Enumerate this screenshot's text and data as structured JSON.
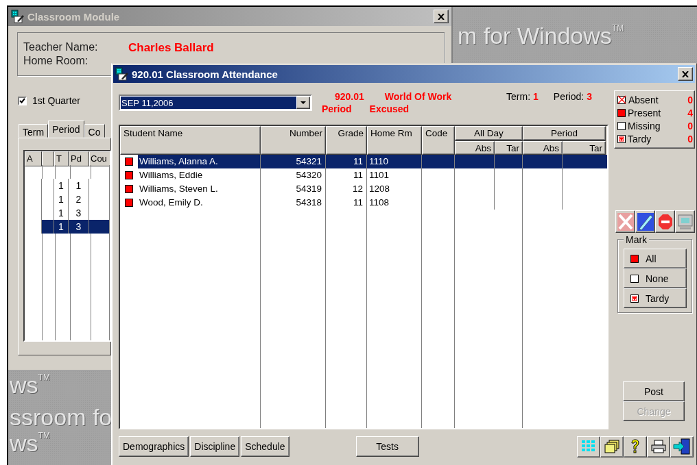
{
  "desktop": {
    "wallpaper_texts": [
      "m for Windows$^{TM}$",
      "ws$^{TM}$",
      "ssroom fo",
      "ws$^{TM}$"
    ]
  },
  "classroom_window": {
    "title": "Classroom Module",
    "teacher_label": "Teacher Name:",
    "teacher_name": "Charles Ballard",
    "home_room_label": "Home Room:",
    "quarter": {
      "label": "1st Quarter",
      "checked": true
    },
    "tabs": [
      {
        "label": "Term",
        "selected": false
      },
      {
        "label": "Period",
        "selected": true
      },
      {
        "label": "Co",
        "selected": false
      }
    ],
    "grid": {
      "columns": [
        "A",
        "T",
        "Pd",
        "Cou"
      ],
      "rows": [
        {
          "t": "1",
          "pd": "1",
          "selected": false
        },
        {
          "t": "1",
          "pd": "2",
          "selected": false
        },
        {
          "t": "1",
          "pd": "3",
          "selected": false
        },
        {
          "t": "1",
          "pd": "3",
          "selected": true
        }
      ]
    }
  },
  "attendance_window": {
    "title": "920.01 Classroom Attendance",
    "date": "SEP 11,2006",
    "course_number": "920.01",
    "course_name": "World Of Work",
    "line_2": [
      "Period",
      "Excused"
    ],
    "term_label": "Term:",
    "term": "1",
    "period_label": "Period:",
    "period": "3",
    "legend": [
      {
        "kind": "absent",
        "label": "Absent",
        "count": "0"
      },
      {
        "kind": "present",
        "label": "Present",
        "count": "4"
      },
      {
        "kind": "missing",
        "label": "Missing",
        "count": "0"
      },
      {
        "kind": "tardy",
        "label": "Tardy",
        "count": "0"
      }
    ],
    "columns": [
      {
        "label": "Student Name"
      },
      {
        "label": "Number"
      },
      {
        "label": "Grade"
      },
      {
        "label": "Home Rm"
      },
      {
        "label": "Code"
      },
      {
        "label": "All Day",
        "children": [
          "Abs",
          "Tar"
        ]
      },
      {
        "label": "Period",
        "children": [
          "Abs",
          "Tar"
        ]
      }
    ],
    "students": [
      {
        "kind": "present",
        "name": "Williams, Alanna A.",
        "number": "54321",
        "grade": "11",
        "home_rm": "1110",
        "selected": true
      },
      {
        "kind": "present",
        "name": "Williams, Eddie",
        "number": "54320",
        "grade": "11",
        "home_rm": "1101",
        "selected": false
      },
      {
        "kind": "present",
        "name": "Williams, Steven L.",
        "number": "54319",
        "grade": "12",
        "home_rm": "1208",
        "selected": false
      },
      {
        "kind": "present",
        "name": "Wood, Emily D.",
        "number": "54318",
        "grade": "11",
        "home_rm": "1108",
        "selected": false
      }
    ],
    "mark": {
      "title": "Mark",
      "buttons": [
        {
          "kind": "present",
          "label": "All"
        },
        {
          "kind": "missing",
          "label": "None"
        },
        {
          "kind": "tardy",
          "label": "Tardy"
        }
      ]
    },
    "post": {
      "label": "Post",
      "disabled": false
    },
    "change": {
      "label": "Change",
      "disabled": true
    },
    "bottom_buttons": [
      "Demographics",
      "Discipline",
      "Schedule"
    ],
    "tests_button": "Tests"
  }
}
